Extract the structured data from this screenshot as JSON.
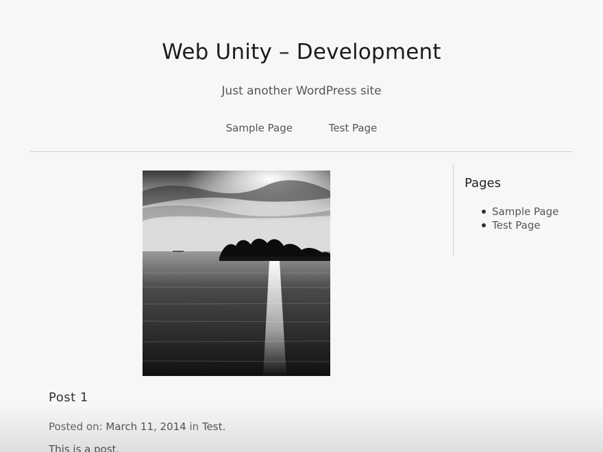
{
  "site": {
    "title": "Web Unity – Development",
    "tagline": "Just another WordPress site"
  },
  "nav": {
    "items": [
      {
        "label": "Sample Page"
      },
      {
        "label": "Test Page"
      }
    ]
  },
  "post": {
    "image_icon": "landscape-photo",
    "title": "Post 1",
    "meta_prefix": "Posted on: ",
    "date": "March 11, 2014",
    "meta_in": " in ",
    "category": "Test",
    "meta_suffix": ".",
    "excerpt": "This is a post."
  },
  "sidebar": {
    "widget_title": "Pages",
    "items": [
      {
        "label": "Sample Page"
      },
      {
        "label": "Test Page"
      }
    ]
  },
  "colors": {
    "background": "#f7f7f7",
    "text": "#222222",
    "muted_text": "#555555",
    "rule": "#d0d0d0"
  }
}
